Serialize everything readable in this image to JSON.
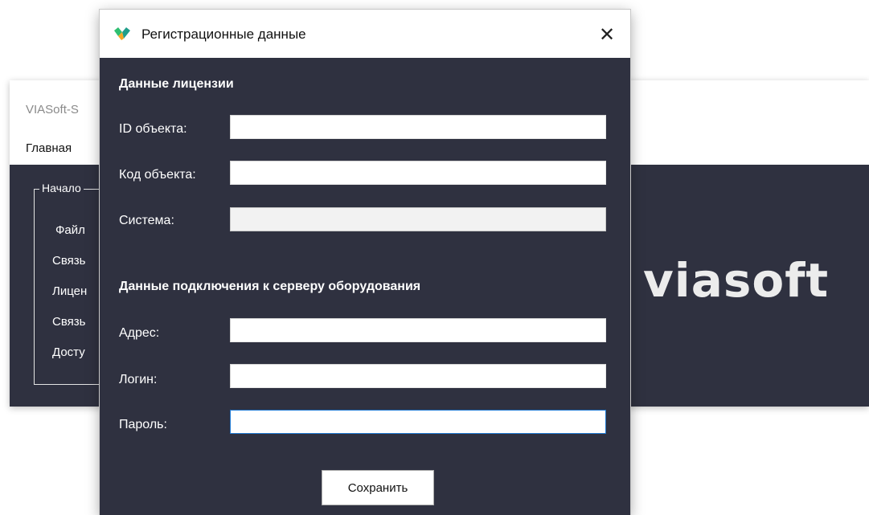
{
  "background_window": {
    "title": "VIASoft-S",
    "menu": {
      "main_label": "Главная"
    },
    "group": {
      "title": "Начало",
      "items": [
        "Файл",
        "Связь",
        "Лицен",
        "Связь",
        "Досту"
      ]
    },
    "logo_text": "viasoft"
  },
  "dialog": {
    "title": "Регистрационные данные",
    "close_symbol": "✕",
    "license_section": {
      "title": "Данные лицензии",
      "fields": {
        "object_id": {
          "label": "ID объекта:",
          "value": ""
        },
        "object_code": {
          "label": "Код объекта:",
          "value": ""
        },
        "system": {
          "label": "Система:",
          "value": ""
        }
      }
    },
    "connection_section": {
      "title": "Данные подключения к серверу оборудования",
      "fields": {
        "address": {
          "label": "Адрес:",
          "value": ""
        },
        "login": {
          "label": "Логин:",
          "value": ""
        },
        "password": {
          "label": "Пароль:",
          "value": ""
        }
      }
    },
    "save_label": "Сохранить"
  },
  "colors": {
    "dialog_background": "#2f3140",
    "logo_green": "#2fbf71",
    "logo_teal": "#1f9e8a",
    "logo_orange": "#f5a623",
    "focus_border": "#1f79d1"
  }
}
